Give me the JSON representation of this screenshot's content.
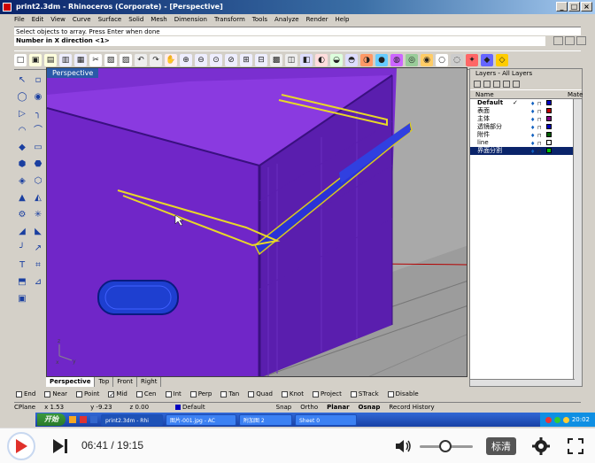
{
  "window": {
    "title": "print2.3dm - Rhinoceros (Corporate) - [Perspective]"
  },
  "menu": [
    "File",
    "Edit",
    "View",
    "Curve",
    "Surface",
    "Solid",
    "Mesh",
    "Dimension",
    "Transform",
    "Tools",
    "Analyze",
    "Render",
    "Help"
  ],
  "command": {
    "history": "Select objects to array. Press Enter when done",
    "prompt": "Number in X direction <1>"
  },
  "viewport": {
    "label": "Perspective",
    "tabs": [
      "Perspective",
      "Top",
      "Front",
      "Right"
    ],
    "active_tab": "Perspective"
  },
  "layers": {
    "title": "Layers - All Layers",
    "col_name": "Name",
    "col_mat": "Mate",
    "rows": [
      {
        "name": "Default",
        "check": "✓",
        "color": "#0000c0",
        "selected": false
      },
      {
        "name": "表面",
        "check": "",
        "color": "#c00000",
        "selected": false
      },
      {
        "name": "主体",
        "check": "",
        "color": "#800080",
        "selected": false
      },
      {
        "name": "透镜部分",
        "check": "",
        "color": "#0000c0",
        "selected": false
      },
      {
        "name": "附件",
        "check": "",
        "color": "#006000",
        "selected": false
      },
      {
        "name": "line",
        "check": "",
        "color": "#ffffff",
        "selected": false
      },
      {
        "name": "界面分割",
        "check": "",
        "color": "#00c000",
        "selected": true
      }
    ]
  },
  "osnap": [
    {
      "label": "End",
      "on": false
    },
    {
      "label": "Near",
      "on": false
    },
    {
      "label": "Point",
      "on": false
    },
    {
      "label": "Mid",
      "on": true
    },
    {
      "label": "Cen",
      "on": false
    },
    {
      "label": "Int",
      "on": false
    },
    {
      "label": "Perp",
      "on": false
    },
    {
      "label": "Tan",
      "on": false
    },
    {
      "label": "Quad",
      "on": false
    },
    {
      "label": "Knot",
      "on": false
    },
    {
      "label": "Project",
      "on": false
    },
    {
      "label": "STrack",
      "on": false
    },
    {
      "label": "Disable",
      "on": false
    }
  ],
  "status": {
    "cplane": "CPlane",
    "x": "x 1.53",
    "y": "y -9.23",
    "z": "z 0.00",
    "layer": "Default",
    "snap": "Snap",
    "ortho": "Ortho",
    "planar": "Planar",
    "osnap": "Osnap",
    "history": "Record History"
  },
  "taskbar": {
    "start": "开始",
    "tasks": [
      {
        "label": "print2.3dm - Rhi",
        "active": true
      },
      {
        "label": "图片-001.jpg - AC",
        "active": false
      },
      {
        "label": "附加图 2",
        "active": false
      },
      {
        "label": "Sheet 0",
        "active": false
      }
    ],
    "clock": "20:02"
  },
  "player": {
    "current": "06:41",
    "total": "19:15",
    "quality": "标清"
  }
}
